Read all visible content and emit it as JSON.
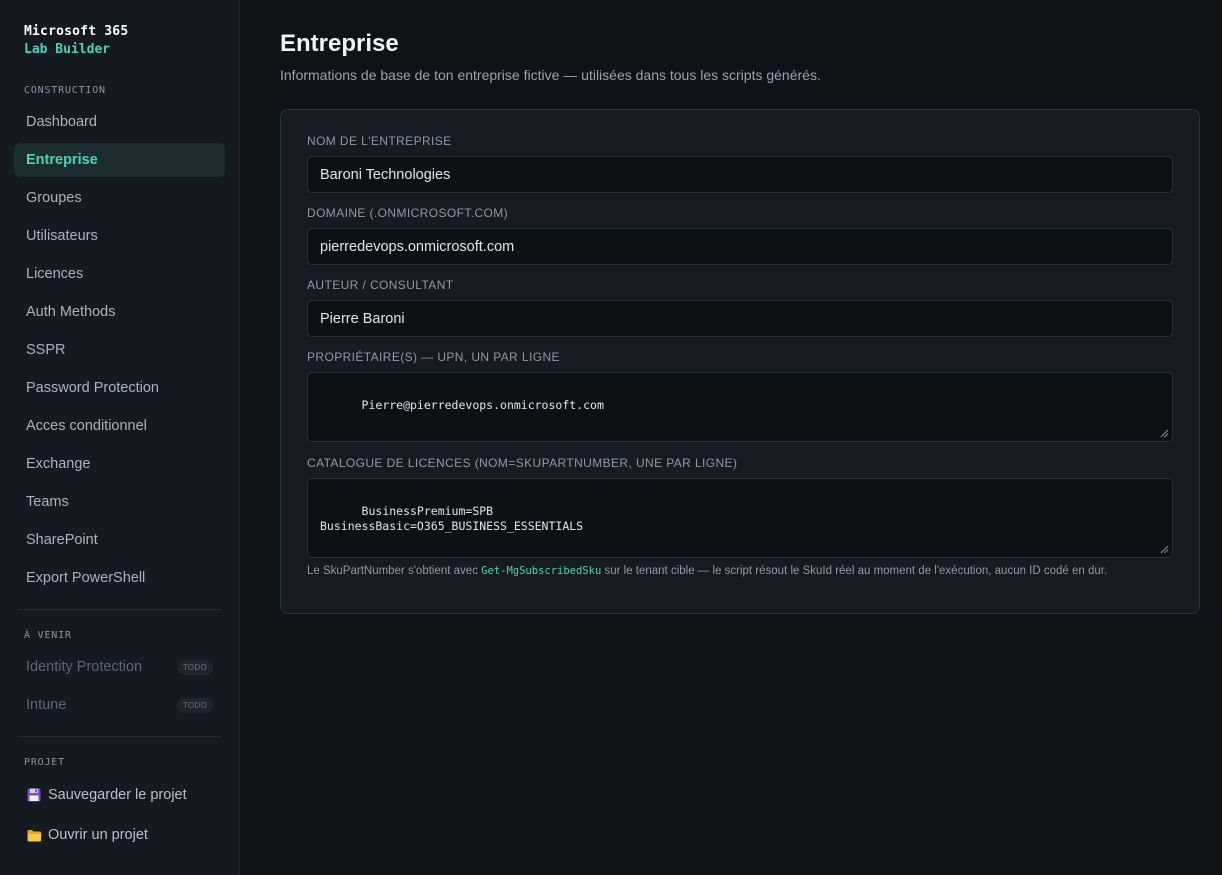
{
  "sidebar": {
    "brand_line1": "Microsoft 365",
    "brand_line2": "Lab Builder",
    "construction_label": "CONSTRUCTION",
    "items": [
      {
        "label": "Dashboard"
      },
      {
        "label": "Entreprise",
        "active": true
      },
      {
        "label": "Groupes"
      },
      {
        "label": "Utilisateurs"
      },
      {
        "label": "Licences"
      },
      {
        "label": "Auth Methods"
      },
      {
        "label": "SSPR"
      },
      {
        "label": "Password Protection"
      },
      {
        "label": "Acces conditionnel"
      },
      {
        "label": "Exchange"
      },
      {
        "label": "Teams"
      },
      {
        "label": "SharePoint"
      },
      {
        "label": "Export PowerShell"
      }
    ],
    "upcoming_label": "À VENIR",
    "upcoming": [
      {
        "label": "Identity Protection",
        "badge": "TODO"
      },
      {
        "label": "Intune",
        "badge": "TODO"
      }
    ],
    "project_label": "PROJET",
    "project_actions": [
      {
        "label": "Sauvegarder le projet",
        "icon": "floppy-disk-icon"
      },
      {
        "label": "Ouvrir un projet",
        "icon": "folder-icon"
      }
    ]
  },
  "main": {
    "title": "Entreprise",
    "subtitle": "Informations de base de ton entreprise fictive — utilisées dans tous les scripts générés.",
    "fields": {
      "company_label": "NOM DE L'ENTREPRISE",
      "company_value": "Baroni Technologies",
      "domain_label": "DOMAINE (.ONMICROSOFT.COM)",
      "domain_value": "pierredevops.onmicrosoft.com",
      "author_label": "AUTEUR / CONSULTANT",
      "author_value": "Pierre Baroni",
      "owners_label": "PROPRIÉTAIRE(S) — UPN, UN PAR LIGNE",
      "owners_value": "Pierre@pierredevops.onmicrosoft.com",
      "catalog_label": "CATALOGUE DE LICENCES (NOM=SKUPARTNUMBER, UNE PAR LIGNE)",
      "catalog_value": "BusinessPremium=SPB\nBusinessBasic=O365_BUSINESS_ESSENTIALS"
    },
    "hint_prefix": "Le SkuPartNumber s'obtient avec ",
    "hint_code": "Get-MgSubscribedSku",
    "hint_suffix": " sur le tenant cible — le script résout le SkuId réel au moment de l'exécution, aucun ID codé en dur."
  },
  "colors": {
    "accent": "#4fd1b5",
    "background": "#0f1217",
    "sidebar": "#151a21",
    "card": "#161b22"
  }
}
